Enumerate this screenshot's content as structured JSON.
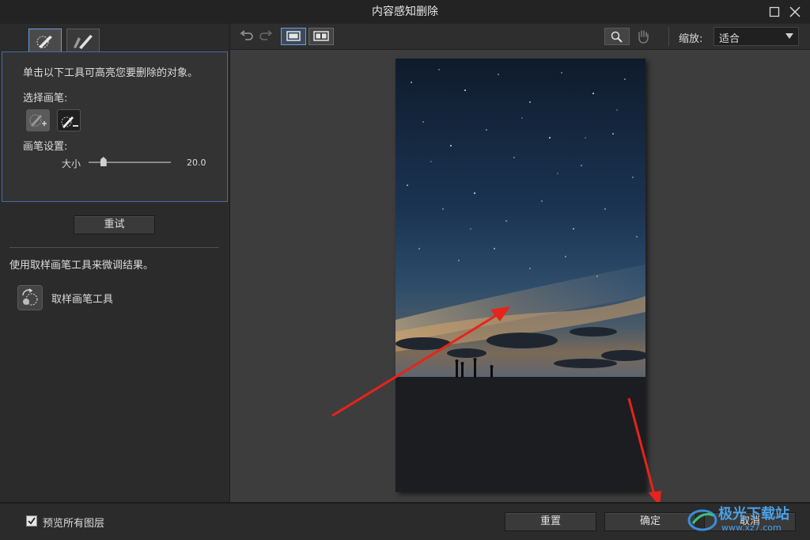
{
  "window": {
    "title": "内容感知删除",
    "maximize_icon": "maximize-icon",
    "close_icon": "close-icon"
  },
  "left_panel": {
    "tabs": [
      {
        "icon": "brush-remove-icon",
        "active": true
      },
      {
        "icon": "brush-edit-icon",
        "active": false
      }
    ],
    "instruction": "单击以下工具可高亮您要删除的对象。",
    "select_brush_label": "选择画笔:",
    "brush_tools": [
      {
        "icon": "brush-add-icon",
        "selected": false
      },
      {
        "icon": "brush-subtract-icon",
        "selected": true
      }
    ],
    "brush_settings_label": "画笔设置:",
    "size_label": "大小",
    "size_value": "20.0",
    "size_fraction": 0.18,
    "retry_button": "重试",
    "refine_hint": "使用取样画笔工具来微调结果。",
    "sample_tool_label": "取样画笔工具"
  },
  "toolbar": {
    "undo_icon": "undo-icon",
    "redo_icon": "redo-icon",
    "single_view_icon": "single-view-icon",
    "split_view_icon": "split-view-icon",
    "zoom_tool_icon": "magnifier-icon",
    "hand_tool_icon": "hand-icon",
    "zoom_label": "缩放:",
    "zoom_value": "适合"
  },
  "footer": {
    "preview_all_layers_label": "预览所有图层",
    "preview_all_layers_checked": true,
    "reset_button": "重置",
    "ok_button": "确定",
    "cancel_button": "取消"
  },
  "watermark": {
    "text": "极光下载站",
    "url": "www.xz7.com"
  },
  "colors": {
    "accent": "#3f6ea6",
    "annotation_arrow": "#e8231a"
  }
}
